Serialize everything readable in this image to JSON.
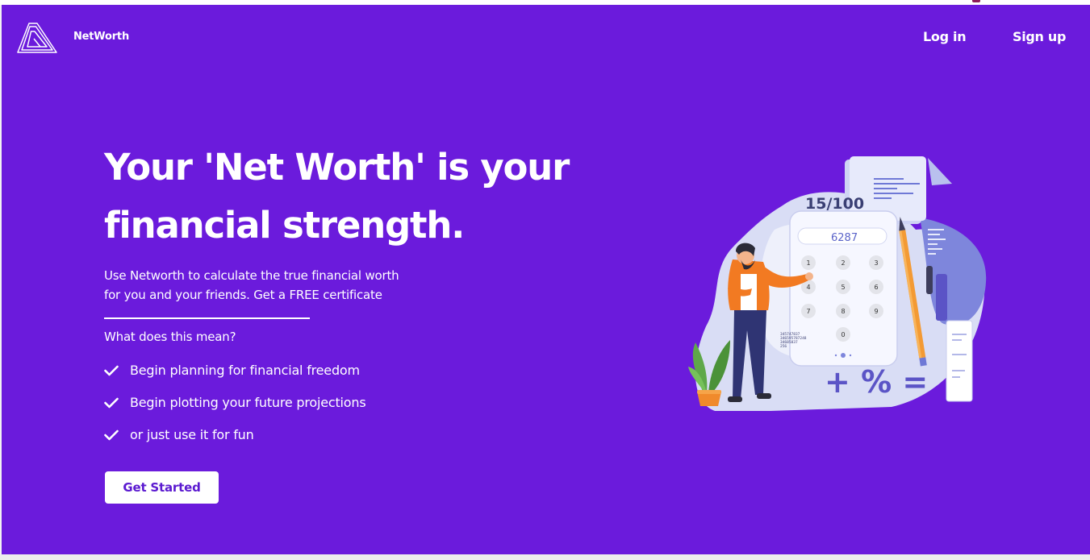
{
  "brand": {
    "name": "NetWorth",
    "logo_icon": "triangle-logo-icon"
  },
  "nav": {
    "login": "Log in",
    "signup": "Sign up"
  },
  "hero": {
    "headline_line1": "Your 'Net Worth' is your",
    "headline_line2": "financial strength.",
    "description_line1": "Use Networth to calculate the true financial worth",
    "description_line2": "for you and your friends. Get a FREE certificate",
    "question": "What does this mean?",
    "features": [
      {
        "icon": "check-icon",
        "label": "Begin planning for financial freedom"
      },
      {
        "icon": "check-icon",
        "label": "Begin plotting your future projections"
      },
      {
        "icon": "check-icon",
        "label": "or just use it for fun"
      }
    ],
    "cta_label": "Get Started"
  },
  "illustration": {
    "score": "15/100",
    "display": "6287",
    "keys": [
      "1",
      "2",
      "3",
      "4",
      "5",
      "6",
      "7",
      "8",
      "9",
      "0"
    ],
    "symbols": "+ % =",
    "notes": [
      "345747837",
      "346595787248",
      "34685837",
      "256"
    ]
  },
  "colors": {
    "background": "#6b1bdc",
    "accent": "#5b1ad0",
    "text": "#ffffff"
  }
}
